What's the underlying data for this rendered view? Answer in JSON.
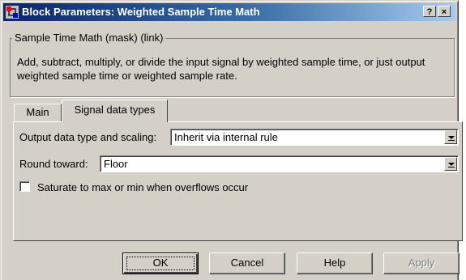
{
  "window": {
    "title": "Block Parameters: Weighted Sample Time Math",
    "help_button": "?",
    "close_button": "×"
  },
  "group": {
    "label": "Sample Time Math (mask) (link)",
    "description": "Add, subtract, multiply, or divide the input signal by weighted sample time, or just output weighted sample time or weighted sample rate."
  },
  "tabs": [
    {
      "label": "Main",
      "selected": false
    },
    {
      "label": "Signal data types",
      "selected": true
    }
  ],
  "signal_panel": {
    "output_label": "Output data type and scaling:",
    "output_value": "Inherit via internal rule",
    "round_label": "Round toward:",
    "round_value": "Floor",
    "saturate_label": "Saturate to max or min when overflows occur",
    "saturate_checked": false
  },
  "buttons": {
    "ok": "OK",
    "cancel": "Cancel",
    "help": "Help",
    "apply": "Apply"
  },
  "colors": {
    "title_bar_start": "#0a246a",
    "title_bar_end": "#a6caf0",
    "dialog_face": "#d4d0c8"
  }
}
